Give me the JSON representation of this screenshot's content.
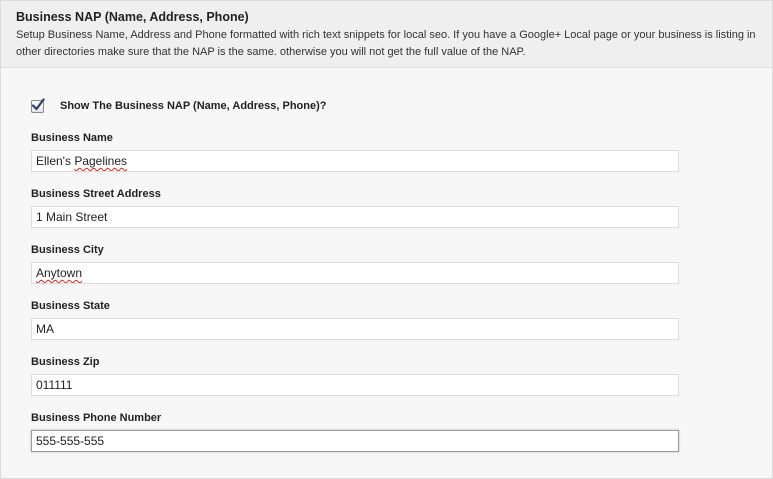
{
  "section": {
    "title": "Business NAP (Name, Address, Phone)",
    "description": "Setup Business Name, Address and Phone formatted with rich text snippets for local seo. If you have a Google+ Local page or your business is listing in other directories make sure that the NAP is the same. otherwise you will not get the full value of the NAP."
  },
  "show_nap": {
    "label": "Show The Business NAP (Name, Address, Phone)?",
    "checked": true
  },
  "fields": {
    "name": {
      "label": "Business Name",
      "value_prefix": "Ellen's ",
      "value_misspelled": "Pagelines"
    },
    "street": {
      "label": "Business Street Address",
      "value": "1 Main Street"
    },
    "city": {
      "label": "Business City",
      "value": "Anytown"
    },
    "state": {
      "label": "Business State",
      "value": "MA"
    },
    "zip": {
      "label": "Business Zip",
      "value": "011111"
    },
    "phone": {
      "label": "Business Phone Number",
      "value": "555-555-555"
    }
  }
}
